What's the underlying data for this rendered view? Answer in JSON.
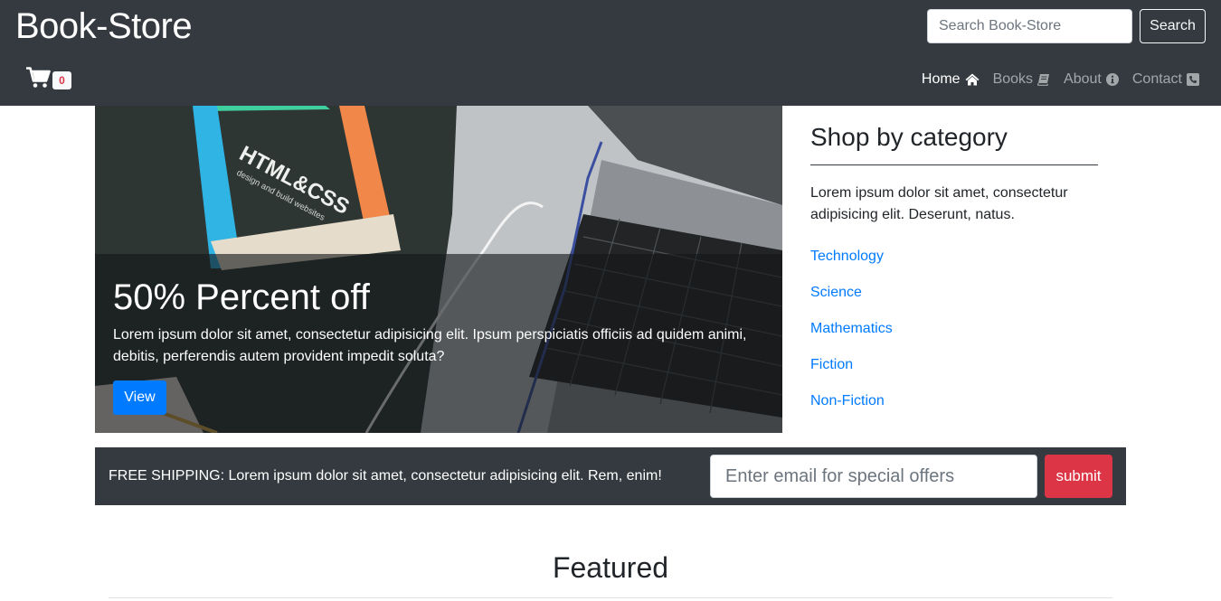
{
  "navbar": {
    "brand": "Book-Store",
    "search_placeholder": "Search Book-Store",
    "search_button": "Search",
    "cart_icon": "shopping-cart-icon",
    "cart_count": "0",
    "links": [
      {
        "label": "Home",
        "icon": "home-icon",
        "active": true
      },
      {
        "label": "Books",
        "icon": "book-icon",
        "active": false
      },
      {
        "label": "About",
        "icon": "info-circle-icon",
        "active": false
      },
      {
        "label": "Contact",
        "icon": "phone-icon",
        "active": false
      }
    ]
  },
  "hero": {
    "book_cover_title": "HTML&CSS",
    "book_cover_subtitle": "design and build websites",
    "title": "50% Percent off",
    "text": "Lorem ipsum dolor sit amet, consectetur adipisicing elit. Ipsum perspiciatis officiis ad quidem animi, debitis, perferendis autem provident impedit soluta?",
    "button": "View"
  },
  "categories": {
    "title": "Shop by category",
    "text": "Lorem ipsum dolor sit amet, consectetur adipisicing elit. Deserunt, natus.",
    "items": [
      "Technology",
      "Science",
      "Mathematics",
      "Fiction",
      "Non-Fiction"
    ]
  },
  "shipping": {
    "text": "FREE SHIPPING: Lorem ipsum dolor sit amet, consectetur adipisicing elit. Rem, enim!",
    "email_placeholder": "Enter email for special offers",
    "submit": "submit"
  },
  "featured": {
    "title": "Featured"
  },
  "colors": {
    "navbar_bg": "#343a40",
    "primary": "#007bff",
    "danger": "#dc3545",
    "link": "#007bff"
  }
}
